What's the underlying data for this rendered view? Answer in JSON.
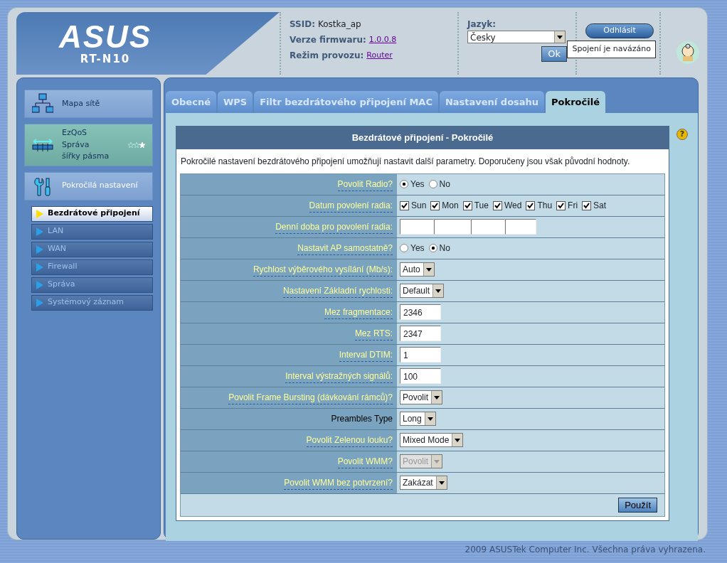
{
  "header": {
    "logo": "ASUS",
    "model": "RT-N10",
    "info": [
      {
        "label": "SSID:",
        "value": "Kostka_ap",
        "kind": "text"
      },
      {
        "label": "Verze firmwaru:",
        "value": "1.0.0.8",
        "kind": "link"
      },
      {
        "label": "Režim provozu:",
        "value": "Router",
        "kind": "link"
      }
    ],
    "language": {
      "label": "Jazyk:",
      "value": "Česky",
      "button": "Ok"
    },
    "logout": "Odhlásit",
    "tooltip": "Spojení je navázáno"
  },
  "sidebar": {
    "main": [
      {
        "lines": [
          "Mapa sítě"
        ],
        "kind": "network"
      },
      {
        "lines": [
          "EzQoS",
          "Správa",
          "šířky pásma"
        ],
        "kind": "qos",
        "stars": 1
      },
      {
        "lines": [
          "Pokročilá nastavení"
        ],
        "kind": "tools"
      }
    ],
    "submenu": [
      {
        "label": "Bezdrátové připojení",
        "selected": true
      },
      {
        "label": "LAN",
        "selected": false
      },
      {
        "label": "WAN",
        "selected": false
      },
      {
        "label": "Firewall",
        "selected": false
      },
      {
        "label": "Správa",
        "selected": false
      },
      {
        "label": "Systémový záznam",
        "selected": false
      }
    ]
  },
  "tabs": [
    {
      "label": "Obecné",
      "selected": false
    },
    {
      "label": "WPS",
      "selected": false
    },
    {
      "label": "Filtr bezdrátového připojení MAC",
      "selected": false
    },
    {
      "label": "Nastavení dosahu",
      "selected": false
    },
    {
      "label": "Pokročilé",
      "selected": true
    }
  ],
  "help": "?",
  "panel": {
    "title": "Bezdrátové připojení - Pokročilé",
    "description": "Pokročilé nastavení bezdrátového připojení umožňují nastavit další parametry. Doporučeny jsou však původní hodnoty.",
    "rows": [
      {
        "label": "Povolit Radio?",
        "hint": true,
        "kind": "radio",
        "options": [
          {
            "label": "Yes",
            "selected": true
          },
          {
            "label": "No",
            "selected": false
          }
        ]
      },
      {
        "label": "Datum povolení radia:",
        "hint": true,
        "kind": "checkboxes",
        "options": [
          {
            "label": "Sun",
            "checked": true
          },
          {
            "label": "Mon",
            "checked": true
          },
          {
            "label": "Tue",
            "checked": true
          },
          {
            "label": "Wed",
            "checked": true
          },
          {
            "label": "Thu",
            "checked": true
          },
          {
            "label": "Fri",
            "checked": true
          },
          {
            "label": "Sat",
            "checked": true
          }
        ]
      },
      {
        "label": "Denní doba pro povolení radia:",
        "hint": true,
        "kind": "time"
      },
      {
        "label": "Nastavit AP samostatně?",
        "hint": true,
        "kind": "radio",
        "options": [
          {
            "label": "Yes",
            "selected": false
          },
          {
            "label": "No",
            "selected": true
          }
        ]
      },
      {
        "label": "Rychlost výběrového vysílání (Mb/s):",
        "hint": true,
        "kind": "select",
        "value": "Auto",
        "disabled": false
      },
      {
        "label": "Nastavení Základní rychlosti:",
        "hint": true,
        "kind": "select",
        "value": "Default",
        "disabled": false
      },
      {
        "label": "Mez fragmentace:",
        "hint": true,
        "kind": "input",
        "value": "2346"
      },
      {
        "label": "Mez RTS:",
        "hint": true,
        "kind": "input",
        "value": "2347"
      },
      {
        "label": "Interval DTIM:",
        "hint": true,
        "kind": "input",
        "value": "1"
      },
      {
        "label": "Interval výstražných signálů:",
        "hint": true,
        "kind": "input",
        "value": "100"
      },
      {
        "label": "Povolit Frame Bursting (dávkování rámců)?",
        "hint": true,
        "kind": "select",
        "value": "Povolit",
        "disabled": false
      },
      {
        "label": "Preambles Type",
        "hint": false,
        "kind": "select",
        "value": "Long",
        "disabled": false
      },
      {
        "label": "Povolit Zelenou louku?",
        "hint": true,
        "kind": "select",
        "value": "Mixed Mode",
        "disabled": false
      },
      {
        "label": "Povolit WMM?",
        "hint": true,
        "kind": "select",
        "value": "Povolit",
        "disabled": true
      },
      {
        "label": "Povolit WMM bez potvrzení?",
        "hint": true,
        "kind": "select",
        "value": "Zakázat",
        "disabled": false
      }
    ],
    "apply": "Použít"
  },
  "footer": "2009 ASUSTek Computer Inc. Všechna práva vyhrazena."
}
